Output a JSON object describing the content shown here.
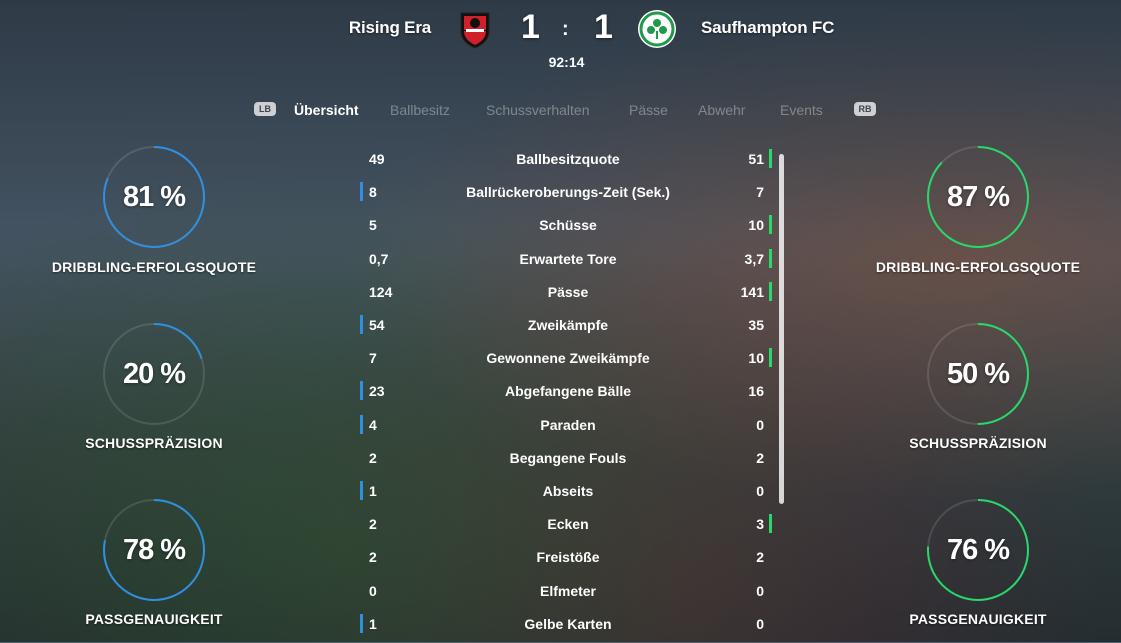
{
  "match": {
    "home_name": "Rising Era",
    "away_name": "Saufhampton FC",
    "home_score": "1",
    "away_score": "1",
    "separator": ":",
    "clock": "92:14",
    "home_crest_color": "#d0202a",
    "away_crest_color": "#1e9a4a"
  },
  "tabs": {
    "lb": "LB",
    "rb": "RB",
    "items": [
      {
        "label": "Übersicht",
        "active": true
      },
      {
        "label": "Ballbesitz",
        "active": false
      },
      {
        "label": "Schussverhalten",
        "active": false
      },
      {
        "label": "Pässe",
        "active": false
      },
      {
        "label": "Abwehr",
        "active": false
      },
      {
        "label": "Events",
        "active": false
      }
    ]
  },
  "colors": {
    "home_accent": "#2f8fe0",
    "away_accent": "#27d86a"
  },
  "stats": [
    {
      "home": "49",
      "name": "Ballbesitzquote",
      "away": "51",
      "leader": "away"
    },
    {
      "home": "8",
      "name": "Ballrückeroberungs-Zeit (Sek.)",
      "away": "7",
      "leader": "home"
    },
    {
      "home": "5",
      "name": "Schüsse",
      "away": "10",
      "leader": "away"
    },
    {
      "home": "0,7",
      "name": "Erwartete Tore",
      "away": "3,7",
      "leader": "away"
    },
    {
      "home": "124",
      "name": "Pässe",
      "away": "141",
      "leader": "away"
    },
    {
      "home": "54",
      "name": "Zweikämpfe",
      "away": "35",
      "leader": "home"
    },
    {
      "home": "7",
      "name": "Gewonnene Zweikämpfe",
      "away": "10",
      "leader": "away"
    },
    {
      "home": "23",
      "name": "Abgefangene Bälle",
      "away": "16",
      "leader": "home"
    },
    {
      "home": "4",
      "name": "Paraden",
      "away": "0",
      "leader": "home"
    },
    {
      "home": "2",
      "name": "Begangene Fouls",
      "away": "2",
      "leader": "none"
    },
    {
      "home": "1",
      "name": "Abseits",
      "away": "0",
      "leader": "home"
    },
    {
      "home": "2",
      "name": "Ecken",
      "away": "3",
      "leader": "away"
    },
    {
      "home": "2",
      "name": "Freistöße",
      "away": "2",
      "leader": "none"
    },
    {
      "home": "0",
      "name": "Elfmeter",
      "away": "0",
      "leader": "none"
    },
    {
      "home": "1",
      "name": "Gelbe Karten",
      "away": "0",
      "leader": "home"
    }
  ],
  "rings": {
    "home": [
      {
        "value": "81 %",
        "fraction": 0.81,
        "label": "DRIBBLING-ERFOLGSQUOTE"
      },
      {
        "value": "20 %",
        "fraction": 0.2,
        "label": "SCHUSSPRÄZISION"
      },
      {
        "value": "78 %",
        "fraction": 0.78,
        "label": "PASSGENAUIGKEIT"
      }
    ],
    "away": [
      {
        "value": "87 %",
        "fraction": 0.87,
        "label": "DRIBBLING-ERFOLGSQUOTE"
      },
      {
        "value": "50 %",
        "fraction": 0.5,
        "label": "SCHUSSPRÄZISION"
      },
      {
        "value": "76 %",
        "fraction": 0.76,
        "label": "PASSGENAUIGKEIT"
      }
    ]
  }
}
